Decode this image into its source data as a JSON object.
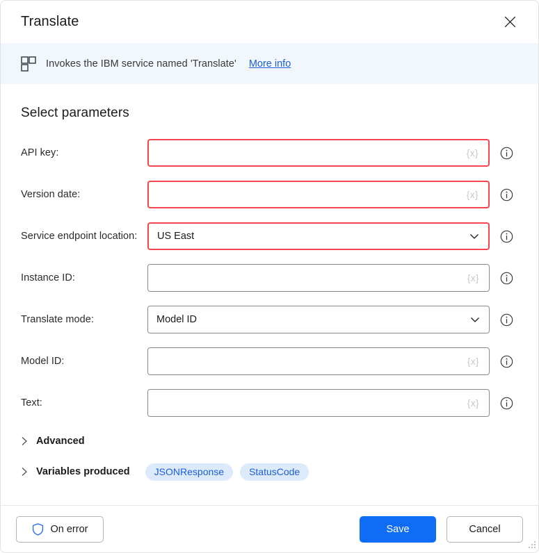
{
  "window": {
    "title": "Translate",
    "close_icon": "close-icon"
  },
  "banner": {
    "icon": "modules-grid-icon",
    "text": "Invokes the IBM service named 'Translate'",
    "link_label": "More info",
    "background": "#f2f6fd",
    "link_color": "#1a5fd6"
  },
  "main": {
    "section_title": "Select parameters",
    "placeholder_token": "{x}",
    "invalid_border_color": "#f5444c",
    "fields": [
      {
        "label": "API key:",
        "type": "text",
        "value": "",
        "placeholder": "{x}",
        "invalid": true,
        "info_icon": "info-icon"
      },
      {
        "label": "Version date:",
        "type": "text",
        "value": "",
        "placeholder": "{x}",
        "invalid": true,
        "info_icon": "info-icon"
      },
      {
        "label": "Service endpoint location:",
        "type": "select",
        "value": "US East",
        "placeholder": "",
        "invalid": true,
        "info_icon": "info-icon"
      },
      {
        "label": "Instance ID:",
        "type": "text",
        "value": "",
        "placeholder": "{x}",
        "invalid": false,
        "info_icon": "info-icon"
      },
      {
        "label": "Translate mode:",
        "type": "select",
        "value": "Model ID",
        "placeholder": "",
        "invalid": false,
        "info_icon": "info-icon"
      },
      {
        "label": "Model ID:",
        "type": "text",
        "value": "",
        "placeholder": "{x}",
        "invalid": false,
        "info_icon": "info-icon"
      },
      {
        "label": "Text:",
        "type": "text",
        "value": "",
        "placeholder": "{x}",
        "invalid": false,
        "info_icon": "info-icon"
      }
    ],
    "advanced": {
      "label": "Advanced",
      "expanded": false,
      "chevron_icon": "chevron-right-icon"
    },
    "variables_produced": {
      "label": "Variables produced",
      "expanded": false,
      "chevron_icon": "chevron-right-icon",
      "badges": [
        "JSONResponse",
        "StatusCode"
      ],
      "badge_background": "#ddeafc",
      "badge_color": "#1a5fd6"
    }
  },
  "footer": {
    "on_error_label": "On error",
    "on_error_icon": "shield-icon",
    "save_label": "Save",
    "cancel_label": "Cancel",
    "save_color": "#0f6cf5"
  }
}
